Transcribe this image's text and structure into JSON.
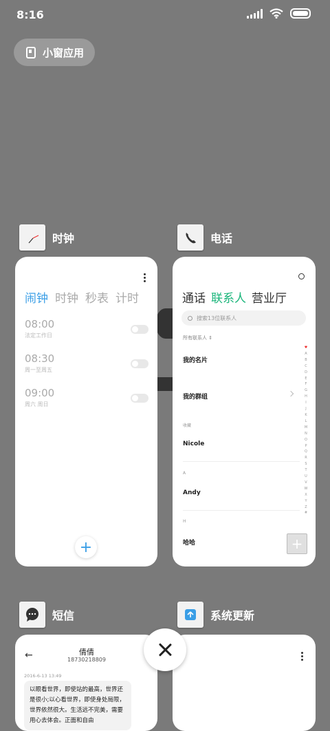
{
  "status_bar": {
    "time": "8:16"
  },
  "floating_window": {
    "label": "小窗应用"
  },
  "apps": {
    "clock": {
      "name": "时钟",
      "tabs": [
        "闹钟",
        "时钟",
        "秒表",
        "计时"
      ],
      "alarms": [
        {
          "time": "08:00",
          "repeat": "法定工作日"
        },
        {
          "time": "08:30",
          "repeat": "周一至周五"
        },
        {
          "time": "09:00",
          "repeat": "周六 周日"
        }
      ],
      "add": "+"
    },
    "phone": {
      "name": "电话",
      "tabs": [
        "通话",
        "联系人",
        "营业厅"
      ],
      "search_placeholder": "搜索13位联系人",
      "all_contacts": "所有联系人",
      "my_card": "我的名片",
      "my_groups": "我的群组",
      "section_fav": "收藏",
      "contact_1": "Nicole",
      "section_a": "A",
      "contact_2": "Andy",
      "section_h": "H",
      "contact_3": "哈哈",
      "index_letters": [
        "A",
        "B",
        "C",
        "D",
        "E",
        "F",
        "G",
        "H",
        "I",
        "J",
        "K",
        "L",
        "M",
        "N",
        "O",
        "P",
        "Q",
        "R",
        "S",
        "T",
        "U",
        "V",
        "W",
        "X",
        "Y",
        "Z",
        "#"
      ],
      "add": "+"
    },
    "sms": {
      "name": "短信",
      "contact_name": "倩倩",
      "contact_number": "18730218809",
      "date": "2016-6-13 13:49",
      "message": "以眼看世界，即使站的最高，世界还是很小;以心看世界，即使身处局限，世界依然很大。生活远不完美，需要用心去体会。正面和自由"
    },
    "update": {
      "name": "系统更新"
    }
  }
}
